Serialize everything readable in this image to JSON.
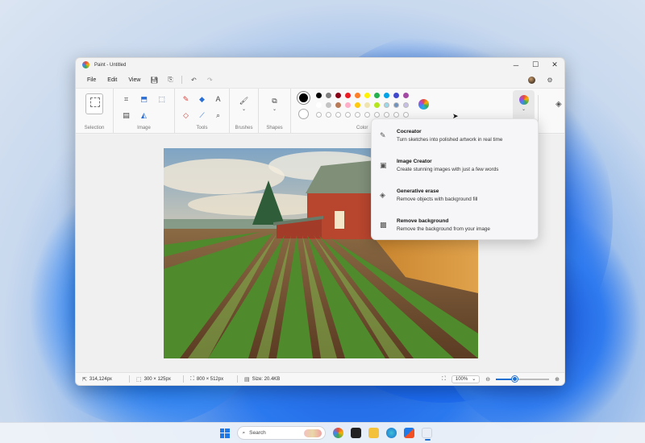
{
  "window": {
    "title": "Paint - Untitled",
    "controls": [
      "─",
      "☐",
      "✕"
    ]
  },
  "menu": {
    "file": "File",
    "edit": "Edit",
    "view": "View"
  },
  "ribbon": {
    "groups": [
      "Selection",
      "Image",
      "Tools",
      "Brushes",
      "Shapes",
      "Color"
    ],
    "primary_color": "#000000",
    "secondary_color": "#ffffff",
    "palette": [
      "#000000",
      "#7f7f7f",
      "#880015",
      "#ed1c24",
      "#ff7f27",
      "#fff200",
      "#22b14c",
      "#00a2e8",
      "#3f48cc",
      "#a349a4",
      "#ffffff",
      "#c3c3c3",
      "#b97a57",
      "#ffaec9",
      "#ffc90e",
      "#efe4b0",
      "#b5e61d",
      "#99d9ea",
      "#7092be",
      "#c8bfe7"
    ]
  },
  "cocreate_menu": [
    {
      "icon": "cocreator-icon",
      "glyph": "✎",
      "title": "Cocreator",
      "desc": "Turn sketches into polished artwork in real time"
    },
    {
      "icon": "image-creator-icon",
      "glyph": "▣",
      "title": "Image Creator",
      "desc": "Create stunning images with just a few words"
    },
    {
      "icon": "generative-erase-icon",
      "glyph": "◈",
      "title": "Generative erase",
      "desc": "Remove objects with background fill"
    },
    {
      "icon": "remove-background-icon",
      "glyph": "▩",
      "title": "Remove background",
      "desc": "Remove the background from your image"
    }
  ],
  "status": {
    "cursor": "314,124px",
    "selection": "300 × 125px",
    "canvas": "800 × 512px",
    "size": "Size: 20.4KB",
    "zoom": "100%",
    "zoom_fraction": 0.35
  },
  "taskbar": {
    "search_placeholder": "Search"
  }
}
